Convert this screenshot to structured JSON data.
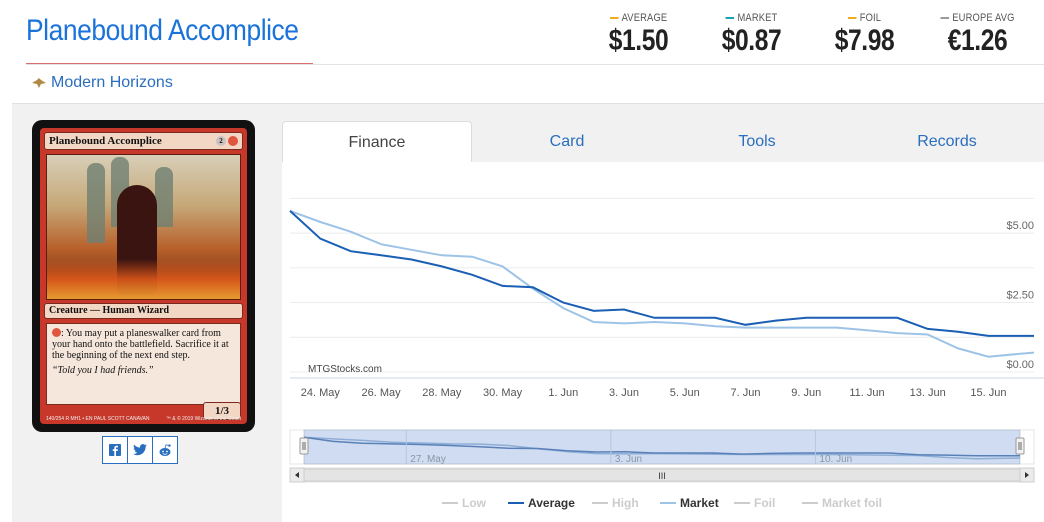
{
  "header": {
    "title": "Planebound Accomplice",
    "set_name": "Modern Horizons",
    "prices": [
      {
        "label": "AVERAGE",
        "value": "$1.50",
        "color": "#f0ad1e"
      },
      {
        "label": "MARKET",
        "value": "$0.87",
        "color": "#17a2b8"
      },
      {
        "label": "FOIL",
        "value": "$7.98",
        "color": "#f0ad1e"
      },
      {
        "label": "EUROPE AVG",
        "value": "€1.26",
        "color": "#999999"
      }
    ]
  },
  "card": {
    "name": "Planebound Accomplice",
    "type_line": "Creature — Human Wizard",
    "rules_text": ": You may put a planeswalker card from your hand onto the battlefield. Sacrifice it at the beginning of the next end step.",
    "flavor_text": "“Told you I had friends.”",
    "pt": "1/3",
    "mana_cost": "2",
    "collector": "140/254 R",
    "set_code": "MH1 • EN",
    "artist": "PAUL SCOTT CANAVAN",
    "copyright": "™ & © 2019 Wizards of the Coast"
  },
  "share": {
    "facebook": "facebook-icon",
    "twitter": "twitter-icon",
    "reddit": "reddit-icon"
  },
  "tabs": [
    {
      "label": "Finance",
      "active": true
    },
    {
      "label": "Card",
      "active": false
    },
    {
      "label": "Tools",
      "active": false
    },
    {
      "label": "Records",
      "active": false
    }
  ],
  "chart_data": {
    "type": "line",
    "watermark": "MTGStocks.com",
    "x_ticks": [
      "24. May",
      "26. May",
      "28. May",
      "30. May",
      "1. Jun",
      "3. Jun",
      "5. Jun",
      "7. Jun",
      "9. Jun",
      "11. Jun",
      "13. Jun",
      "15. Jun"
    ],
    "y_ticks": [
      "$0.00",
      "$2.50",
      "$5.00"
    ],
    "ylim": [
      0,
      7.2
    ],
    "x_day_range": [
      23.0,
      47.5
    ],
    "series": [
      {
        "name": "Average",
        "color": "#1a5fb4",
        "x": [
          23,
          24,
          25,
          26,
          27,
          28,
          29,
          30,
          31,
          32,
          33,
          34,
          35,
          36,
          37,
          38,
          39,
          40,
          41,
          42,
          43,
          44,
          45,
          46,
          47,
          47.5
        ],
        "y": [
          5.8,
          4.8,
          4.35,
          4.2,
          4.05,
          3.8,
          3.5,
          3.1,
          3.05,
          2.5,
          2.2,
          2.25,
          1.95,
          1.95,
          1.95,
          1.7,
          1.85,
          1.95,
          1.95,
          1.95,
          1.95,
          1.55,
          1.45,
          1.3,
          1.3,
          1.3
        ]
      },
      {
        "name": "Market",
        "color": "#9dc3e6",
        "x": [
          23,
          24,
          25,
          26,
          27,
          28,
          29,
          30,
          31,
          32,
          33,
          34,
          35,
          36,
          37,
          38,
          39,
          40,
          41,
          42,
          43,
          44,
          45,
          46,
          47,
          47.5
        ],
        "y": [
          5.8,
          5.4,
          5.05,
          4.6,
          4.4,
          4.2,
          4.15,
          3.8,
          3.0,
          2.3,
          1.8,
          1.75,
          1.8,
          1.75,
          1.65,
          1.6,
          1.6,
          1.6,
          1.6,
          1.5,
          1.4,
          1.35,
          0.85,
          0.55,
          0.65,
          0.7
        ]
      }
    ],
    "legend": [
      {
        "name": "Low",
        "color": "#cccccc",
        "active": false
      },
      {
        "name": "Average",
        "color": "#1a5fb4",
        "active": true
      },
      {
        "name": "High",
        "color": "#cccccc",
        "active": false
      },
      {
        "name": "Market",
        "color": "#9dc3e6",
        "active": true
      },
      {
        "name": "Foil",
        "color": "#cccccc",
        "active": false
      },
      {
        "name": "Market foil",
        "color": "#cccccc",
        "active": false
      }
    ],
    "navigator_labels": [
      "27. May",
      "3. Jun",
      "10. Jun"
    ],
    "scrollbar_grip": "III"
  }
}
